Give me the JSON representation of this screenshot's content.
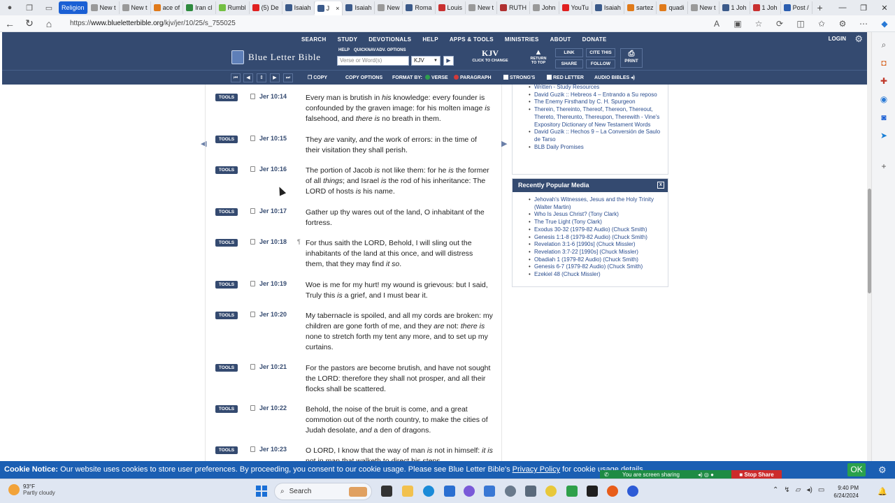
{
  "browser": {
    "tabs": [
      {
        "label": "Religion",
        "kind": "group",
        "color": "#1a5fd4"
      },
      {
        "label": "New t",
        "color": "#999999"
      },
      {
        "label": "New t",
        "color": "#999999"
      },
      {
        "label": "ace of",
        "color": "#e07a1a"
      },
      {
        "label": "Iran cl",
        "color": "#2e8a3e"
      },
      {
        "label": "Rumbl",
        "color": "#74c043"
      },
      {
        "label": "(5) De",
        "color": "#e02020"
      },
      {
        "label": "Isaiah",
        "color": "#3b5a8a"
      },
      {
        "label": "J",
        "color": "#3b5a8a",
        "active": true
      },
      {
        "label": "Isaiah",
        "color": "#3b5a8a"
      },
      {
        "label": "New",
        "color": "#999999"
      },
      {
        "label": "Roma",
        "color": "#3b5a8a"
      },
      {
        "label": "Louis",
        "color": "#c93030"
      },
      {
        "label": "New t",
        "color": "#999999"
      },
      {
        "label": "RUTH",
        "color": "#b03030"
      },
      {
        "label": "John",
        "color": "#999999"
      },
      {
        "label": "YouTu",
        "color": "#e02020"
      },
      {
        "label": "Isaiah",
        "color": "#3b5a8a"
      },
      {
        "label": "sartez",
        "color": "#e07a1a"
      },
      {
        "label": "quadi",
        "color": "#e07a1a"
      },
      {
        "label": "New t",
        "color": "#999999"
      },
      {
        "label": "1 Joh",
        "color": "#3b5a8a"
      },
      {
        "label": "1 Joh",
        "color": "#c93030"
      },
      {
        "label": "Post /",
        "color": "#2a5db0"
      }
    ],
    "close_glyph": "×",
    "new_tab_glyph": "+",
    "url_prefix": "https://",
    "url_host": "www.blueletterbible.org",
    "url_path": "/kjv/jer/10/25/s_755025"
  },
  "site": {
    "nav": [
      "SEARCH",
      "STUDY",
      "DEVOTIONALS",
      "HELP",
      "APPS & TOOLS",
      "MINISTRIES",
      "ABOUT",
      "DONATE"
    ],
    "login": "LOGIN",
    "logo": "Blue Letter Bible",
    "help": "HELP",
    "quicknav": "QUICKNAV",
    "adv": "ADV. OPTIONS",
    "search_placeholder": "Verse or Word(s)",
    "version_select": "KJV",
    "kjv_big": "KJV",
    "kjv_small": "CLICK TO CHANGE",
    "return_top": "RETURN TO TOP",
    "link": "LINK",
    "cite": "CITE THIS",
    "share": "SHARE",
    "follow": "FOLLOW",
    "print": "PRINT",
    "toolbar": {
      "copy": "COPY",
      "copy_options": "COPY OPTIONS",
      "format_by": "FORMAT BY:",
      "verse": "VERSE",
      "paragraph": "PARAGRAPH",
      "strongs": "STRONG'S",
      "red_letter": "RED LETTER",
      "audio": "AUDIO BIBLES"
    }
  },
  "tools_label": "TOOLS",
  "verses": [
    {
      "ref": "Jer 10:14",
      "html": "Every man is brutish in <i>his</i> knowledge: every founder is confounded by the graven image: for his molten image <i>is</i> falsehood, and <i>there is</i> no breath in them."
    },
    {
      "ref": "Jer 10:15",
      "html": "They <i>are</i> vanity, <i>and</i> the work of errors: in the time of their visitation they shall perish."
    },
    {
      "ref": "Jer 10:16",
      "html": "The portion of Jacob <i>is</i> not like them: for he <i>is</i> the former of all <i>things</i>; and Israel <i>is</i> the rod of his inheritance: The LORD of hosts <i>is</i> his name."
    },
    {
      "ref": "Jer 10:17",
      "html": "Gather up thy wares out of the land, O inhabitant of the fortress."
    },
    {
      "ref": "Jer 10:18",
      "para": "¶",
      "html": "For thus saith the LORD, Behold, I will sling out the inhabitants of the land at this once, and will distress them, that they may find <i>it so</i>."
    },
    {
      "ref": "Jer 10:19",
      "html": "Woe is me for my hurt! my wound is grievous: but I said, Truly this <i>is</i> a grief, and I must bear it."
    },
    {
      "ref": "Jer 10:20",
      "html": "My tabernacle is spoiled, and all my cords are broken: my children are gone forth of me, and they <i>are</i> not: <i>there is</i> none to stretch forth my tent any more, and to set up my curtains."
    },
    {
      "ref": "Jer 10:21",
      "html": "For the pastors are become brutish, and have not sought the LORD: therefore they shall not prosper, and all their flocks shall be scattered."
    },
    {
      "ref": "Jer 10:22",
      "html": "Behold, the noise of the bruit is come, and a great commotion out of the north country, to make the cities of Judah desolate, <i>and</i> a den of dragons."
    },
    {
      "ref": "Jer 10:23",
      "html": "O LORD, I know that the way of man <i>is</i> not in himself: <i>it is</i> not in man that walketh to direct his steps."
    }
  ],
  "sidebar": {
    "resources": [
      "Written - Study Resources",
      "David Guzik :: Hebreos 4 – Entrando a Su reposo",
      "The Enemy Firsthand by C. H. Spurgeon",
      "Therein, Thereinto, Thereof, Thereon, Thereout, Thereto, Thereunto, Thereupon, Therewith - Vine's Expository Dictionary of New Testament Words",
      "David Guzik :: Hechos 9 – La Conversión de Saulo de Tarso",
      "BLB Daily Promises"
    ],
    "popular_title": "Recently Popular Media",
    "popular_close": "x",
    "popular": [
      "Jehovah's Witnesses, Jesus and the Holy Trinity (Walter Martin)",
      "Who Is Jesus Christ? (Tony Clark)",
      "The True Light (Tony Clark)",
      "Exodus 30-32 (1979-82 Audio) (Chuck Smith)",
      "Genesis 1:1-8 (1979-82 Audio) (Chuck Smith)",
      "Revelation 3:1-6 [1990s] (Chuck Missler)",
      "Revelation 3:7-22 [1990s] (Chuck Missler)",
      "Obadiah 1 (1979-82 Audio) (Chuck Smith)",
      "Genesis 6-7 (1979-82 Audio) (Chuck Smith)",
      "Ezekiel 48 (Chuck Missler)"
    ]
  },
  "cookie": {
    "label": "Cookie Notice:",
    "text": " Our website uses cookies to store user preferences. By proceeding, you consent to our cookie usage. Please see Blue Letter Bible's ",
    "link": "Privacy Policy",
    "tail": " for cookie usage details.",
    "ok": "OK"
  },
  "share": {
    "label": "You are screen sharing",
    "stop": "Stop Share"
  },
  "taskbar": {
    "temp": "93°F",
    "weather": "Partly cloudy",
    "search": "Search",
    "time": "9:40 PM",
    "date": "6/24/2024"
  }
}
